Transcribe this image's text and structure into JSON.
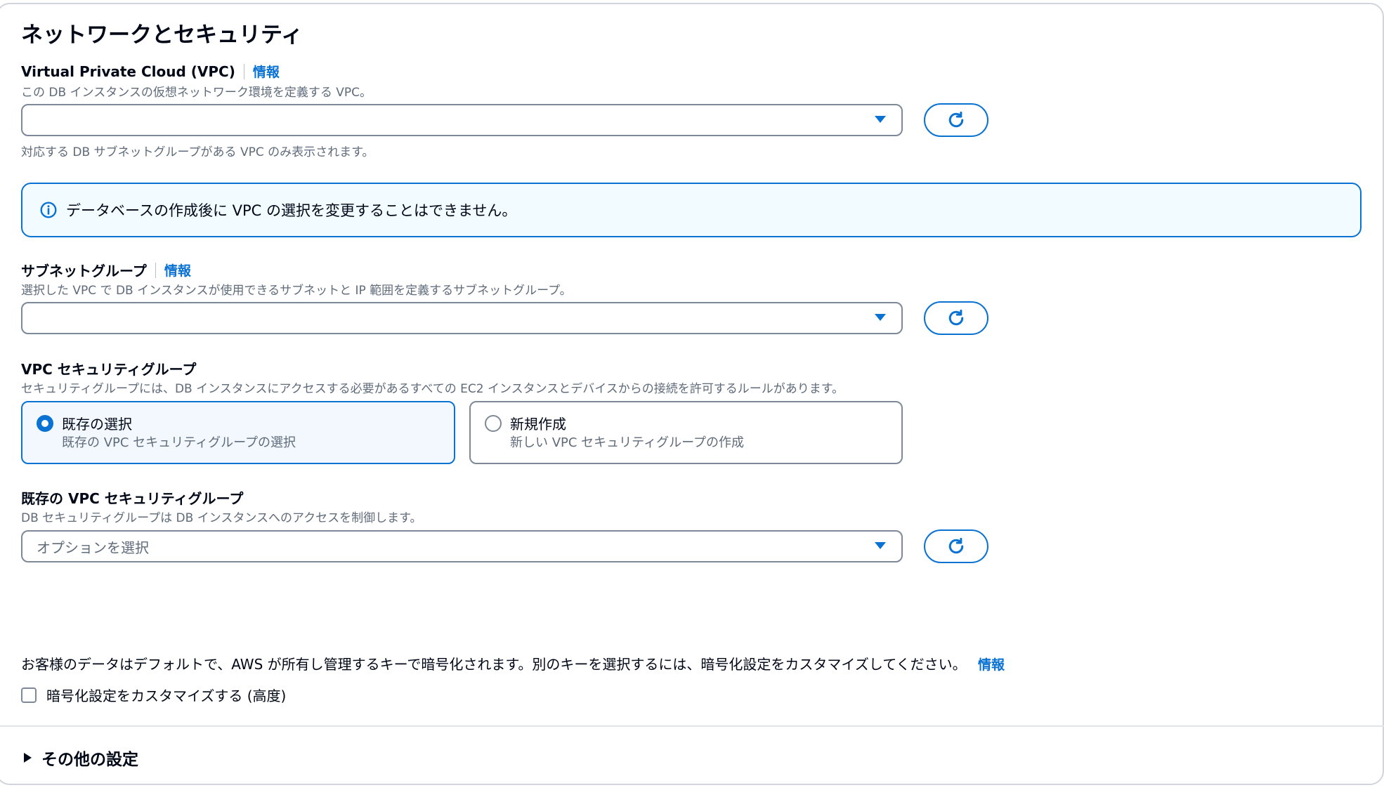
{
  "section": {
    "title": "ネットワークとセキュリティ"
  },
  "vpc": {
    "label": "Virtual Private Cloud (VPC)",
    "info": "情報",
    "description": "この DB インスタンスの仮想ネットワーク環境を定義する VPC。",
    "value": "",
    "hint": "対応する DB サブネットグループがある VPC のみ表示されます。"
  },
  "alert": {
    "text": "データベースの作成後に VPC の選択を変更することはできません。"
  },
  "subnet": {
    "label": "サブネットグループ",
    "info": "情報",
    "description": "選択した VPC で DB インスタンスが使用できるサブネットと IP 範囲を定義するサブネットグループ。",
    "value": ""
  },
  "sg": {
    "label": "VPC セキュリティグループ",
    "description": "セキュリティグループには、DB インスタンスにアクセスする必要があるすべての EC2 インスタンスとデバイスからの接続を許可するルールがあります。",
    "options": [
      {
        "title": "既存の選択",
        "desc": "既存の VPC セキュリティグループの選択",
        "selected": true
      },
      {
        "title": "新規作成",
        "desc": "新しい VPC セキュリティグループの作成",
        "selected": false
      }
    ]
  },
  "existing_sg": {
    "label": "既存の VPC セキュリティグループ",
    "description": "DB セキュリティグループは DB インスタンスへのアクセスを制御します。",
    "placeholder": "オプションを選択"
  },
  "encryption": {
    "text": "お客様のデータはデフォルトで、AWS が所有し管理するキーで暗号化されます。別のキーを選択するには、暗号化設定をカスタマイズしてください。",
    "info": "情報",
    "checkbox_label": "暗号化設定をカスタマイズする (高度)",
    "checked": false
  },
  "other": {
    "label": "その他の設定"
  },
  "colors": {
    "accent": "#0972d3",
    "alert_bg": "#f2fbff",
    "text": "#000716",
    "muted": "#5f6b7a"
  }
}
